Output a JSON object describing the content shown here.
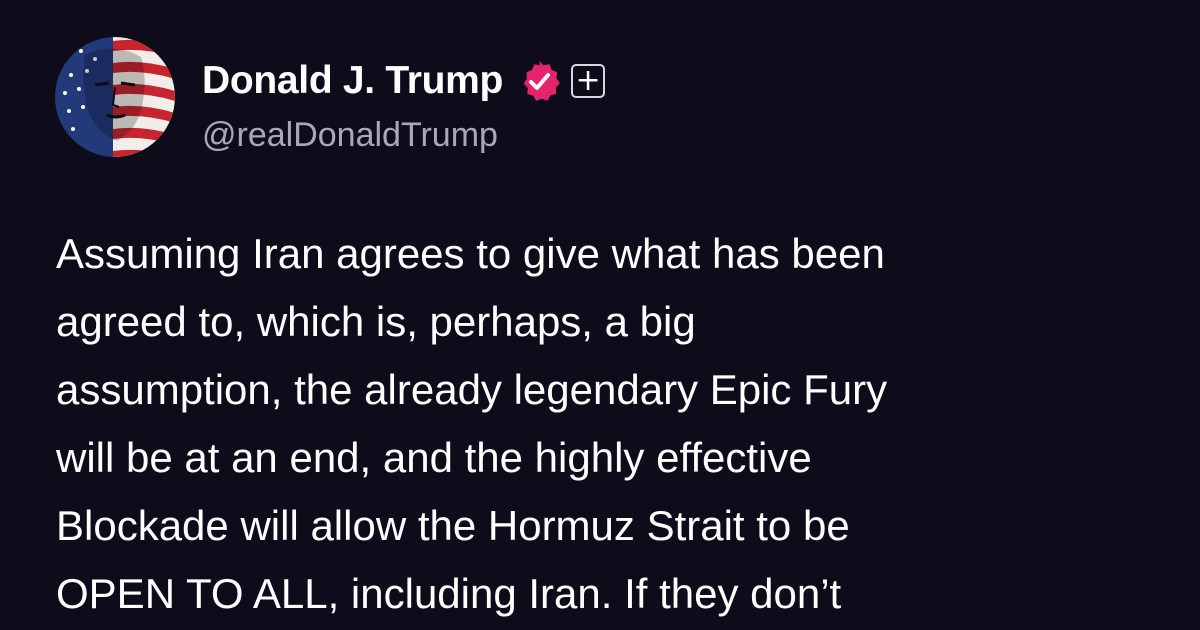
{
  "theme": {
    "background": "#0e0c1b",
    "text": "#ffffff",
    "handle_color": "#a9a8b6",
    "verified_color": "#e6246b"
  },
  "author": {
    "display_name": "Donald J. Trump",
    "handle": "@realDonaldTrump",
    "avatar_icon": "flag-portrait-avatar",
    "verified_icon": "verified-badge-icon",
    "follow_symbol": "+"
  },
  "post": {
    "lines": [
      "Assuming Iran agrees to give what has been",
      "agreed to, which is, perhaps, a big",
      "assumption, the already legendary Epic Fury",
      "will be at an end, and the highly effective",
      "Blockade will allow the Hormuz Strait to be",
      "OPEN TO ALL, including Iran. If they don’t"
    ]
  }
}
